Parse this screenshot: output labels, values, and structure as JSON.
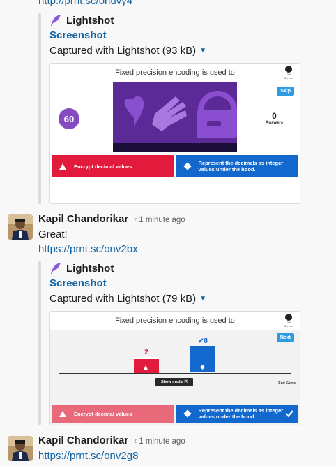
{
  "top_link": "http://prnt.sc/onuvy4",
  "attachments": [
    {
      "provider": "Lightshot",
      "title": "Screenshot",
      "subtitle": "Captured with Lightshot (93 kB)",
      "question": "Fixed precision encoding is used to",
      "fullscreen_label": "Full Screen",
      "top_button": "Skip",
      "timer": "60",
      "answer_count": "0",
      "answer_count_label": "Answers",
      "answers": [
        "Encrypt decimal values",
        "Represent the decimals as integer values under the hood."
      ]
    },
    {
      "provider": "Lightshot",
      "title": "Screenshot",
      "subtitle": "Captured with Lightshot (79 kB)",
      "question": "Fixed precision encoding is used to",
      "fullscreen_label": "Full Screen",
      "top_button": "Next",
      "bar_red_value": "2",
      "bar_blue_value": "8",
      "show_media": "Show media",
      "end_game": "End Game",
      "answers": [
        "Encrypt decimal values",
        "Represent the decimals as integer values under the hood."
      ]
    }
  ],
  "messages": [
    {
      "sender": "Kapil Chandorikar",
      "timestamp": "1 minute ago",
      "text": "Great!",
      "link": "https://prnt.sc/onv2bx"
    },
    {
      "sender": "Kapil Chandorikar",
      "timestamp": "1 minute ago",
      "link": "https://prnt.sc/onv2g8"
    }
  ],
  "colors": {
    "link": "#1264a3",
    "kahoot_red": "#e21b3c",
    "kahoot_blue": "#1368ce",
    "kahoot_purple": "#864cbf"
  }
}
